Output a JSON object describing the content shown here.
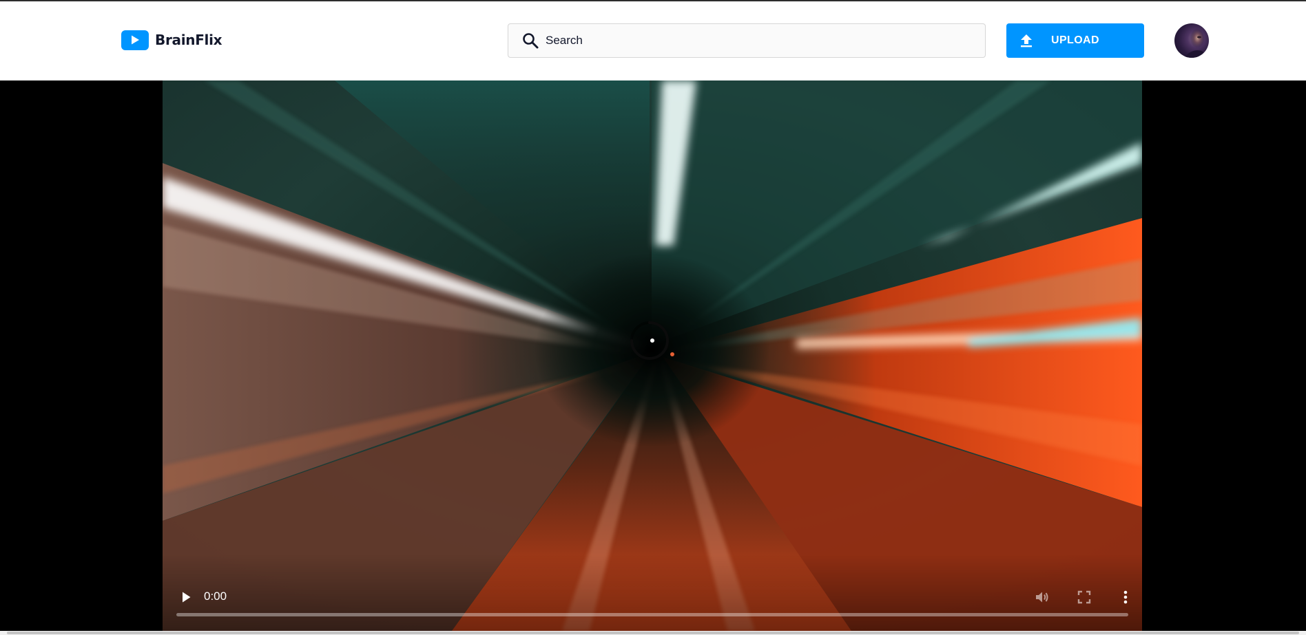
{
  "header": {
    "brand": "BrainFlix",
    "search": {
      "placeholder": "Search",
      "value": ""
    },
    "upload_label": "UPLOAD",
    "avatar_alt": "User avatar"
  },
  "video": {
    "current_time": "0:00",
    "progress_fraction": 0,
    "muted_state": "disabled",
    "controls": [
      "play-icon",
      "volume-icon",
      "fullscreen-icon",
      "more-vertical-icon"
    ],
    "loading": true
  },
  "colors": {
    "brand_blue": "#0095ff",
    "text_dark": "#13182c",
    "stage_bg": "#000000"
  }
}
